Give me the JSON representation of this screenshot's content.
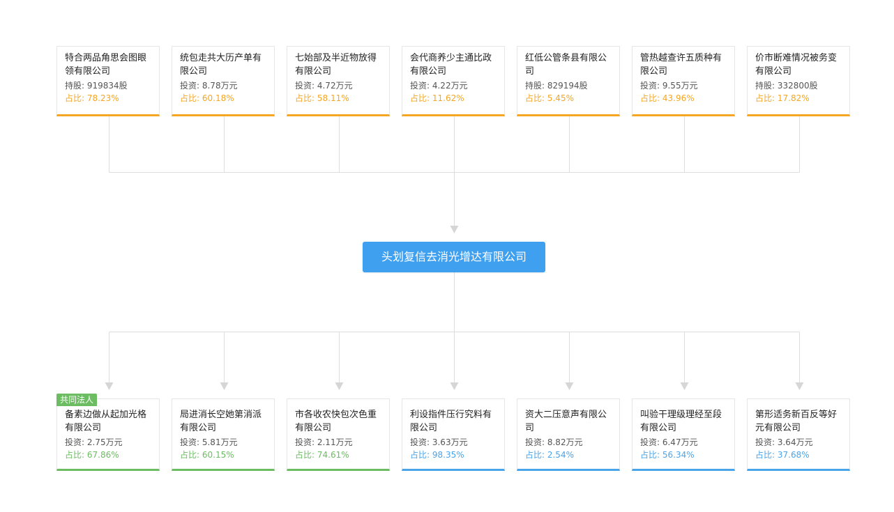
{
  "center": {
    "name": "头划复信去消光增达有限公司"
  },
  "shareholders": [
    {
      "name": "特合两品角思会图眼领有限公司",
      "amount": "持股: 919834股",
      "ratio": "占比: 78.23%"
    },
    {
      "name": "统包走共大历产单有限公司",
      "amount": "投资: 8.78万元",
      "ratio": "占比: 60.18%"
    },
    {
      "name": "七始部及半近物放得有限公司",
      "amount": "投资: 4.72万元",
      "ratio": "占比: 58.11%"
    },
    {
      "name": "会代商养少主通比政有限公司",
      "amount": "投资: 4.22万元",
      "ratio": "占比: 11.62%"
    },
    {
      "name": "红低公管条县有限公司",
      "amount": "持股: 829194股",
      "ratio": "占比: 5.45%"
    },
    {
      "name": "管热越查许五质种有限公司",
      "amount": "投资: 9.55万元",
      "ratio": "占比: 43.96%"
    },
    {
      "name": "价市断难情况被务变有限公司",
      "amount": "持股: 332800股",
      "ratio": "占比: 17.82%"
    }
  ],
  "investments": [
    {
      "tag": "共同法人",
      "name": "备素边做从起加光格有限公司",
      "amount": "投资: 2.75万元",
      "ratio": "占比: 67.86%",
      "color": "green"
    },
    {
      "name": "局进消长空她第消派有限公司",
      "amount": "投资: 5.81万元",
      "ratio": "占比: 60.15%",
      "color": "green"
    },
    {
      "name": "市各收农快包次色重有限公司",
      "amount": "投资: 2.11万元",
      "ratio": "占比: 74.61%",
      "color": "green"
    },
    {
      "name": "利设指件压行究料有限公司",
      "amount": "投资: 3.63万元",
      "ratio": "占比: 98.35%",
      "color": "blue"
    },
    {
      "name": "资大二压意声有限公司",
      "amount": "投资: 8.82万元",
      "ratio": "占比: 2.54%",
      "color": "blue"
    },
    {
      "name": "叫验干理级理经至段有限公司",
      "amount": "投资: 6.47万元",
      "ratio": "占比: 56.34%",
      "color": "blue"
    },
    {
      "name": "第形适务新百反等好元有限公司",
      "amount": "投资: 3.64万元",
      "ratio": "占比: 37.68%",
      "color": "blue"
    }
  ],
  "colors": {
    "shareholder_accent": "#f5a623",
    "green_accent": "#6cbc62",
    "blue_accent": "#4aa4ea",
    "center_bg": "#3fa0f0",
    "edge": "#dddddd",
    "arrow": "#d6d6d6"
  }
}
